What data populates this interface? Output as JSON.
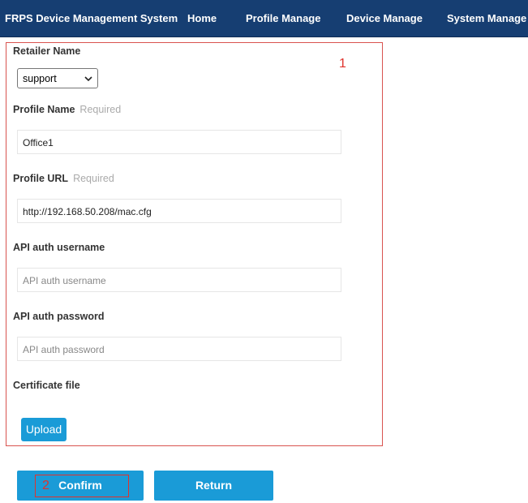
{
  "header": {
    "title": "FRPS Device Management System",
    "nav": [
      "Home",
      "Profile Manage",
      "Device Manage",
      "System Manage"
    ]
  },
  "annotations": {
    "one": "1",
    "two": "2"
  },
  "form": {
    "retailer": {
      "label": "Retailer Name",
      "selected": "support"
    },
    "profile_name": {
      "label": "Profile Name",
      "required": "Required",
      "value": "Office1"
    },
    "profile_url": {
      "label": "Profile URL",
      "required": "Required",
      "value": "http://192.168.50.208/mac.cfg"
    },
    "api_username": {
      "label": "API auth username",
      "placeholder": "API auth username"
    },
    "api_password": {
      "label": "API auth password",
      "placeholder": "API auth password"
    },
    "certificate": {
      "label": "Certificate file",
      "upload_label": "Upload"
    }
  },
  "actions": {
    "confirm_label": "Confirm",
    "return_label": "Return"
  },
  "colors": {
    "header_bg": "#163e72",
    "accent": "#1a9bd7",
    "annotation": "#e0322c"
  }
}
